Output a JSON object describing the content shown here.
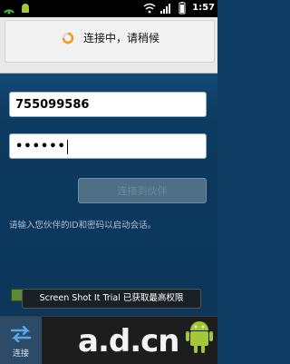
{
  "status_bar": {
    "time": "1:57"
  },
  "dialog": {
    "message": "连接中，请稍候"
  },
  "form": {
    "partner_id": "755099586",
    "password_masked": "••••••",
    "connect_button": "连接到伙伴",
    "hint": "请输入您伙伴的ID和密码以启动会话。"
  },
  "toast": {
    "message": "Screen Shot It Trial 已获取最高权限"
  },
  "bottom_nav": {
    "connect_label": "连接"
  },
  "watermark": {
    "text": "a.d.cn"
  },
  "colors": {
    "status_bar": "#000000",
    "background": "#0f3d63",
    "dialog": "#f2f2f2",
    "spinner": "#f39a1e",
    "nav_active": "#2d4a68"
  },
  "icons": [
    "network-icon",
    "android-debug-icon",
    "wifi-icon",
    "signal-icon",
    "battery-icon",
    "spinner-icon",
    "arrows-icon",
    "android-logo-icon"
  ]
}
